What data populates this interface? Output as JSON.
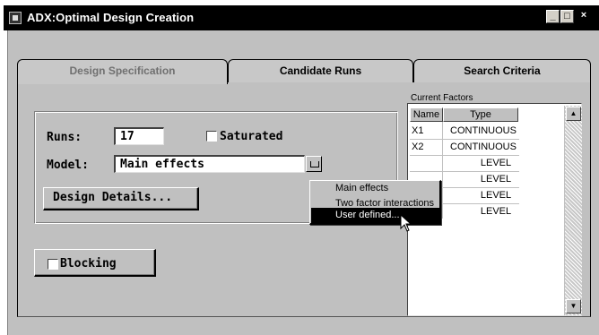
{
  "window": {
    "title": "ADX:Optimal Design Creation",
    "icon": "sas-app-icon",
    "controls": [
      "_",
      "□",
      "×"
    ]
  },
  "tabs": [
    {
      "label": "Design Specification",
      "active": true
    },
    {
      "label": "Candidate Runs",
      "active": false
    },
    {
      "label": "Search Criteria",
      "active": false
    }
  ],
  "design": {
    "runs_label": "Runs:",
    "runs_value": "17",
    "saturated_label": "Saturated",
    "saturated_checked": false,
    "model_label": "Model:",
    "model_value": "Main effects",
    "details_button": "Design Details...",
    "blocking_label": "Blocking",
    "blocking_checked": false
  },
  "factors": {
    "caption": "Current Factors",
    "columns": [
      "Name",
      "Type"
    ],
    "rows": [
      {
        "name": "X1",
        "type": "CONTINUOUS"
      },
      {
        "name": "X2",
        "type": "CONTINUOUS"
      },
      {
        "name": "",
        "type": "LEVEL"
      },
      {
        "name": "",
        "type": "LEVEL"
      },
      {
        "name": "",
        "type": "LEVEL"
      },
      {
        "name": "",
        "type": "LEVEL"
      }
    ]
  },
  "model_menu": {
    "items": [
      "Main effects",
      "Two factor interactions",
      "User defined..."
    ],
    "selected_index": 2
  },
  "colors": {
    "titlebar": "#000000",
    "face": "#c0c0c0",
    "highlight": "#000000"
  }
}
